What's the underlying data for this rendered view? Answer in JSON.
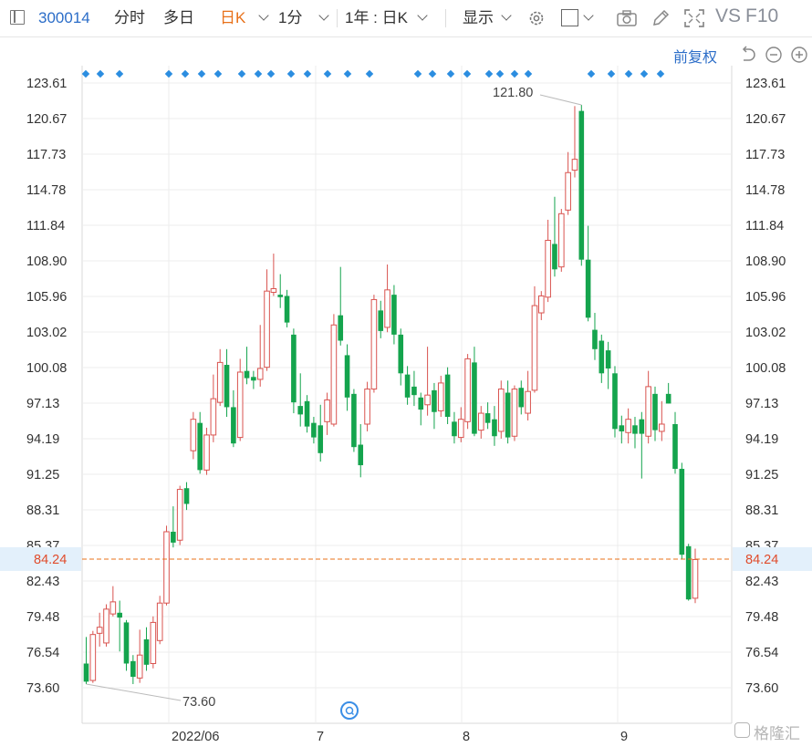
{
  "toolbar": {
    "stock_code": "300014",
    "tab_intraday": "分时",
    "tab_multiday": "多日",
    "tab_daily_k": "日K",
    "tab_minute": "1分",
    "range_select": "1年 : 日K",
    "display_label": "显示",
    "vs_label": "VS",
    "f10_label": "F10"
  },
  "subbar": {
    "adjust_label": "前复权"
  },
  "watermark": "格隆汇",
  "colors": {
    "up": "#d9534f",
    "down": "#14a44d",
    "last_price": "#e8711a",
    "accent": "#2b6dc8",
    "grid": "#ececec"
  },
  "chart_data": {
    "type": "candlestick",
    "y_ticks": [
      "123.61",
      "120.67",
      "117.73",
      "114.78",
      "111.84",
      "108.90",
      "105.96",
      "103.02",
      "100.08",
      "97.13",
      "94.19",
      "91.25",
      "88.31",
      "85.37",
      "82.43",
      "79.48",
      "76.54",
      "73.60"
    ],
    "ylim": [
      73.6,
      123.61
    ],
    "x_labels": [
      "2022/06",
      "7",
      "8",
      "9"
    ],
    "last_price": "84.24",
    "max_label": "121.80",
    "min_label": "73.60",
    "candles": [
      {
        "o": 75.6,
        "c": 74.1,
        "h": 77.8,
        "l": 73.9
      },
      {
        "o": 74.2,
        "c": 78.0,
        "h": 78.3,
        "l": 74.0
      },
      {
        "o": 78.1,
        "c": 78.6,
        "h": 79.8,
        "l": 77.0
      },
      {
        "o": 77.3,
        "c": 80.1,
        "h": 80.5,
        "l": 77.0
      },
      {
        "o": 79.7,
        "c": 80.7,
        "h": 82.0,
        "l": 79.5
      },
      {
        "o": 79.8,
        "c": 79.4,
        "h": 80.8,
        "l": 76.6
      },
      {
        "o": 79.0,
        "c": 75.6,
        "h": 79.2,
        "l": 75.0
      },
      {
        "o": 75.8,
        "c": 74.5,
        "h": 76.3,
        "l": 73.9
      },
      {
        "o": 74.4,
        "c": 76.3,
        "h": 78.4,
        "l": 74.0
      },
      {
        "o": 77.6,
        "c": 75.5,
        "h": 78.6,
        "l": 75.0
      },
      {
        "o": 75.6,
        "c": 79.0,
        "h": 79.5,
        "l": 75.2
      },
      {
        "o": 77.5,
        "c": 80.6,
        "h": 81.2,
        "l": 77.2
      },
      {
        "o": 80.6,
        "c": 86.5,
        "h": 87.0,
        "l": 80.4
      },
      {
        "o": 86.5,
        "c": 85.6,
        "h": 88.6,
        "l": 85.2
      },
      {
        "o": 85.8,
        "c": 90.0,
        "h": 90.3,
        "l": 85.4
      },
      {
        "o": 90.1,
        "c": 88.8,
        "h": 90.6,
        "l": 88.3
      },
      {
        "o": 93.2,
        "c": 95.8,
        "h": 96.4,
        "l": 92.5
      },
      {
        "o": 95.5,
        "c": 91.6,
        "h": 96.4,
        "l": 91.3
      },
      {
        "o": 91.6,
        "c": 94.5,
        "h": 95.1,
        "l": 91.2
      },
      {
        "o": 94.5,
        "c": 97.5,
        "h": 99.5,
        "l": 93.9
      },
      {
        "o": 97.2,
        "c": 100.5,
        "h": 101.6,
        "l": 96.9
      },
      {
        "o": 100.3,
        "c": 96.8,
        "h": 101.6,
        "l": 96.0
      },
      {
        "o": 96.8,
        "c": 93.8,
        "h": 98.2,
        "l": 93.5
      },
      {
        "o": 94.3,
        "c": 99.7,
        "h": 100.8,
        "l": 94.0
      },
      {
        "o": 99.8,
        "c": 99.2,
        "h": 101.8,
        "l": 98.7
      },
      {
        "o": 99.3,
        "c": 99.0,
        "h": 99.8,
        "l": 98.3
      },
      {
        "o": 99.1,
        "c": 100.0,
        "h": 103.6,
        "l": 98.5
      },
      {
        "o": 100.1,
        "c": 106.4,
        "h": 108.2,
        "l": 99.8
      },
      {
        "o": 106.3,
        "c": 106.6,
        "h": 109.5,
        "l": 106.0
      },
      {
        "o": 106.1,
        "c": 105.9,
        "h": 107.8,
        "l": 105.0
      },
      {
        "o": 106.0,
        "c": 103.8,
        "h": 106.5,
        "l": 103.4
      },
      {
        "o": 102.8,
        "c": 97.2,
        "h": 103.3,
        "l": 96.3
      },
      {
        "o": 96.9,
        "c": 96.2,
        "h": 99.6,
        "l": 95.2
      },
      {
        "o": 97.3,
        "c": 95.2,
        "h": 97.8,
        "l": 94.7
      },
      {
        "o": 95.5,
        "c": 94.3,
        "h": 96.0,
        "l": 93.8
      },
      {
        "o": 95.3,
        "c": 93.0,
        "h": 97.0,
        "l": 92.3
      },
      {
        "o": 95.6,
        "c": 97.4,
        "h": 98.0,
        "l": 94.5
      },
      {
        "o": 95.4,
        "c": 103.6,
        "h": 104.5,
        "l": 95.2
      },
      {
        "o": 104.4,
        "c": 102.3,
        "h": 108.4,
        "l": 101.9
      },
      {
        "o": 101.1,
        "c": 97.6,
        "h": 102.0,
        "l": 96.5
      },
      {
        "o": 97.9,
        "c": 93.5,
        "h": 98.3,
        "l": 93.1
      },
      {
        "o": 93.7,
        "c": 92.0,
        "h": 95.4,
        "l": 91.0
      },
      {
        "o": 95.4,
        "c": 98.3,
        "h": 98.9,
        "l": 94.8
      },
      {
        "o": 98.3,
        "c": 105.7,
        "h": 106.1,
        "l": 98.0
      },
      {
        "o": 104.8,
        "c": 103.1,
        "h": 105.6,
        "l": 102.5
      },
      {
        "o": 103.4,
        "c": 106.5,
        "h": 108.6,
        "l": 103.0
      },
      {
        "o": 106.1,
        "c": 102.8,
        "h": 106.9,
        "l": 102.0
      },
      {
        "o": 102.8,
        "c": 99.6,
        "h": 103.3,
        "l": 98.6
      },
      {
        "o": 99.5,
        "c": 97.6,
        "h": 100.2,
        "l": 97.0
      },
      {
        "o": 98.5,
        "c": 97.8,
        "h": 99.8,
        "l": 96.9
      },
      {
        "o": 97.6,
        "c": 96.6,
        "h": 98.0,
        "l": 95.3
      },
      {
        "o": 97.0,
        "c": 97.8,
        "h": 101.8,
        "l": 96.1
      },
      {
        "o": 98.2,
        "c": 96.4,
        "h": 98.8,
        "l": 95.0
      },
      {
        "o": 96.5,
        "c": 98.8,
        "h": 99.4,
        "l": 96.0
      },
      {
        "o": 99.5,
        "c": 96.0,
        "h": 100.1,
        "l": 95.4
      },
      {
        "o": 95.6,
        "c": 94.4,
        "h": 96.4,
        "l": 93.8
      },
      {
        "o": 94.3,
        "c": 95.8,
        "h": 96.8,
        "l": 93.9
      },
      {
        "o": 95.6,
        "c": 100.8,
        "h": 101.2,
        "l": 95.0
      },
      {
        "o": 100.5,
        "c": 94.6,
        "h": 101.8,
        "l": 94.4
      },
      {
        "o": 94.9,
        "c": 96.3,
        "h": 96.9,
        "l": 94.2
      },
      {
        "o": 96.3,
        "c": 95.5,
        "h": 97.2,
        "l": 95.0
      },
      {
        "o": 95.8,
        "c": 94.4,
        "h": 96.9,
        "l": 93.6
      },
      {
        "o": 94.8,
        "c": 98.3,
        "h": 99.0,
        "l": 94.2
      },
      {
        "o": 98.0,
        "c": 94.3,
        "h": 99.0,
        "l": 93.8
      },
      {
        "o": 94.4,
        "c": 98.3,
        "h": 98.6,
        "l": 94.0
      },
      {
        "o": 98.4,
        "c": 96.8,
        "h": 99.0,
        "l": 96.2
      },
      {
        "o": 96.3,
        "c": 98.1,
        "h": 99.8,
        "l": 95.7
      },
      {
        "o": 98.2,
        "c": 105.2,
        "h": 106.8,
        "l": 98.0
      },
      {
        "o": 104.6,
        "c": 106.0,
        "h": 106.4,
        "l": 104.0
      },
      {
        "o": 105.9,
        "c": 110.6,
        "h": 112.3,
        "l": 105.5
      },
      {
        "o": 110.3,
        "c": 108.2,
        "h": 114.2,
        "l": 107.6
      },
      {
        "o": 108.4,
        "c": 112.8,
        "h": 113.2,
        "l": 108.0
      },
      {
        "o": 113.1,
        "c": 116.2,
        "h": 117.9,
        "l": 112.7
      },
      {
        "o": 116.4,
        "c": 117.3,
        "h": 121.7,
        "l": 115.8
      },
      {
        "o": 121.3,
        "c": 109.0,
        "h": 121.8,
        "l": 108.5
      },
      {
        "o": 109.0,
        "c": 104.2,
        "h": 111.8,
        "l": 103.9
      },
      {
        "o": 103.2,
        "c": 101.6,
        "h": 104.6,
        "l": 100.7
      },
      {
        "o": 102.3,
        "c": 99.6,
        "h": 102.8,
        "l": 98.8
      },
      {
        "o": 101.5,
        "c": 100.0,
        "h": 102.2,
        "l": 98.3
      },
      {
        "o": 99.6,
        "c": 95.0,
        "h": 100.2,
        "l": 94.3
      },
      {
        "o": 95.3,
        "c": 94.8,
        "h": 96.1,
        "l": 93.8
      },
      {
        "o": 94.7,
        "c": 95.8,
        "h": 96.7,
        "l": 93.8
      },
      {
        "o": 95.3,
        "c": 94.6,
        "h": 96.0,
        "l": 93.4
      },
      {
        "o": 95.8,
        "c": 94.6,
        "h": 96.4,
        "l": 90.9
      },
      {
        "o": 94.4,
        "c": 98.5,
        "h": 99.8,
        "l": 93.8
      },
      {
        "o": 97.9,
        "c": 94.9,
        "h": 98.5,
        "l": 94.0
      },
      {
        "o": 94.8,
        "c": 95.4,
        "h": 97.3,
        "l": 94.0
      },
      {
        "o": 97.9,
        "c": 97.1,
        "h": 98.8,
        "l": 97.1
      },
      {
        "o": 95.4,
        "c": 91.7,
        "h": 96.4,
        "l": 91.3
      },
      {
        "o": 91.7,
        "c": 84.6,
        "h": 92.2,
        "l": 84.2
      },
      {
        "o": 85.3,
        "c": 80.9,
        "h": 85.5,
        "l": 80.8
      },
      {
        "o": 81.0,
        "c": 84.2,
        "h": 85.1,
        "l": 80.6
      }
    ]
  }
}
